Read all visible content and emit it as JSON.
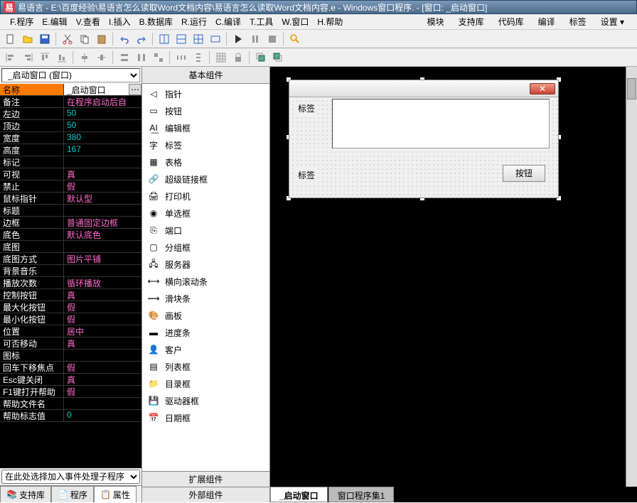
{
  "title": "易语言 - E:\\百度经验\\易语言怎么读取Word文档内容\\易语言怎么读取Word文档内容.e - Windows窗口程序. - [窗口: _启动窗口]",
  "menus": {
    "main": [
      "F.程序",
      "E.编辑",
      "V.查看",
      "I.插入",
      "B.数据库",
      "R.运行",
      "C.编译",
      "T.工具",
      "W.窗口",
      "H.帮助"
    ],
    "right": [
      "模块",
      "支持库",
      "代码库",
      "编译",
      "标签",
      "设置 ▾"
    ]
  },
  "combo": {
    "value": "_启动窗口 (窗口)"
  },
  "propsHeader": {
    "name": "名称",
    "value": "_启动窗口"
  },
  "props": [
    {
      "n": "备注",
      "v": "在程序启动后自",
      "c": ""
    },
    {
      "n": "左边",
      "v": "50",
      "c": "teal"
    },
    {
      "n": "顶边",
      "v": "50",
      "c": "teal"
    },
    {
      "n": "宽度",
      "v": "380",
      "c": "teal"
    },
    {
      "n": "高度",
      "v": "167",
      "c": "teal"
    },
    {
      "n": "标记",
      "v": "",
      "c": ""
    },
    {
      "n": "可视",
      "v": "真",
      "c": ""
    },
    {
      "n": "禁止",
      "v": "假",
      "c": ""
    },
    {
      "n": "鼠标指针",
      "v": "默认型",
      "c": ""
    },
    {
      "n": "标题",
      "v": "",
      "c": ""
    },
    {
      "n": "边框",
      "v": "普通固定边框",
      "c": ""
    },
    {
      "n": "底色",
      "v": "默认底色",
      "c": ""
    },
    {
      "n": "底图",
      "v": "",
      "c": ""
    },
    {
      "n": "  底图方式",
      "v": "图片平铺",
      "c": ""
    },
    {
      "n": "背景音乐",
      "v": "",
      "c": ""
    },
    {
      "n": "  播放次数",
      "v": "循环播放",
      "c": ""
    },
    {
      "n": "控制按钮",
      "v": "真",
      "c": ""
    },
    {
      "n": "  最大化按钮",
      "v": "假",
      "c": ""
    },
    {
      "n": "  最小化按钮",
      "v": "假",
      "c": ""
    },
    {
      "n": "位置",
      "v": "居中",
      "c": ""
    },
    {
      "n": "可否移动",
      "v": "真",
      "c": ""
    },
    {
      "n": "图标",
      "v": "",
      "c": ""
    },
    {
      "n": "回车下移焦点",
      "v": "假",
      "c": ""
    },
    {
      "n": "Esc键关闭",
      "v": "真",
      "c": ""
    },
    {
      "n": "F1键打开帮助",
      "v": "假",
      "c": ""
    },
    {
      "n": "  帮助文件名",
      "v": "",
      "c": ""
    },
    {
      "n": "  帮助标志值",
      "v": "0",
      "c": "teal"
    }
  ],
  "eventCombo": {
    "placeholder": "在此处选择加入事件处理子程序"
  },
  "leftTabs": {
    "t1": "支持库",
    "t2": "程序",
    "t3": "属性"
  },
  "midHead": "基本组件",
  "components": [
    "指针",
    "按钮",
    "编辑框",
    "标签",
    "表格",
    "超级链接框",
    "打印机",
    "单选框",
    "端口",
    "分组框",
    "服务器",
    "横向滚动条",
    "滑块条",
    "画板",
    "进度条",
    "客户",
    "列表框",
    "目录框",
    "驱动器框",
    "日期框"
  ],
  "midFoot": {
    "f1": "扩展组件",
    "f2": "外部组件"
  },
  "designTabs": {
    "t1": "_启动窗口",
    "t2": "窗口程序集1"
  },
  "preview": {
    "label1": "标签",
    "label2": "标签",
    "button": "按钮"
  }
}
